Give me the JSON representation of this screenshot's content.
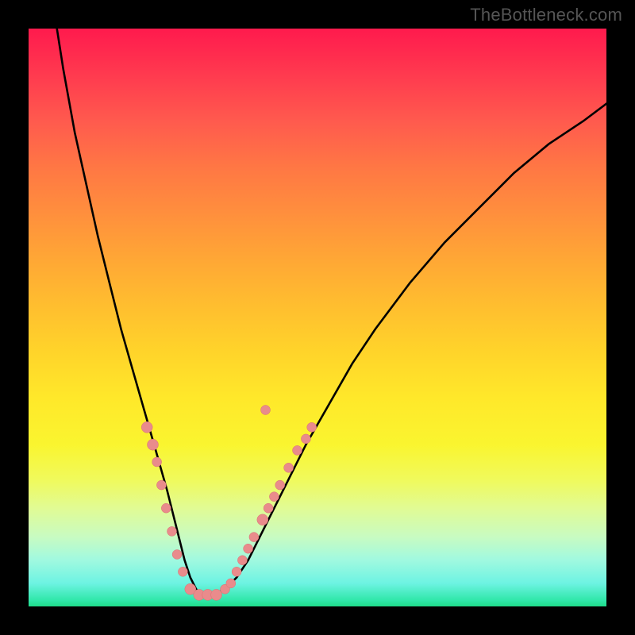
{
  "watermark": "TheBottleneck.com",
  "chart_data": {
    "type": "line",
    "title": "",
    "xlabel": "",
    "ylabel": "",
    "xlim": [
      0,
      100
    ],
    "ylim": [
      0,
      100
    ],
    "grid": false,
    "legend": false,
    "annotations": [],
    "series": [
      {
        "name": "bottleneck-curve",
        "color": "#000000",
        "x": [
          4.9,
          6,
          8,
          10,
          12,
          14,
          16,
          18,
          20,
          22,
          24,
          25,
          26,
          27,
          28,
          29,
          30,
          32,
          34,
          36,
          38,
          40,
          44,
          48,
          52,
          56,
          60,
          66,
          72,
          78,
          84,
          90,
          96,
          100
        ],
        "y": [
          100,
          93,
          82,
          73,
          64,
          56,
          48,
          41,
          34,
          27,
          20,
          16,
          12,
          8,
          5,
          3,
          2,
          2,
          3,
          5,
          8,
          12,
          20,
          28,
          35,
          42,
          48,
          56,
          63,
          69,
          75,
          80,
          84,
          87
        ]
      }
    ],
    "markers": [
      {
        "x": 20.5,
        "y": 31,
        "r": 7
      },
      {
        "x": 21.5,
        "y": 28,
        "r": 7
      },
      {
        "x": 22.2,
        "y": 25,
        "r": 6
      },
      {
        "x": 23.0,
        "y": 21,
        "r": 6
      },
      {
        "x": 23.8,
        "y": 17,
        "r": 6
      },
      {
        "x": 24.8,
        "y": 13,
        "r": 6
      },
      {
        "x": 25.7,
        "y": 9,
        "r": 6
      },
      {
        "x": 26.7,
        "y": 6,
        "r": 6
      },
      {
        "x": 28.0,
        "y": 3,
        "r": 7
      },
      {
        "x": 29.5,
        "y": 2,
        "r": 7
      },
      {
        "x": 31.0,
        "y": 2,
        "r": 7
      },
      {
        "x": 32.5,
        "y": 2,
        "r": 7
      },
      {
        "x": 34.0,
        "y": 3,
        "r": 6
      },
      {
        "x": 35.0,
        "y": 4,
        "r": 6
      },
      {
        "x": 36.0,
        "y": 6,
        "r": 6
      },
      {
        "x": 37.0,
        "y": 8,
        "r": 6
      },
      {
        "x": 38.0,
        "y": 10,
        "r": 6
      },
      {
        "x": 39.0,
        "y": 12,
        "r": 6
      },
      {
        "x": 40.5,
        "y": 15,
        "r": 7
      },
      {
        "x": 41.5,
        "y": 17,
        "r": 6
      },
      {
        "x": 42.5,
        "y": 19,
        "r": 6
      },
      {
        "x": 43.5,
        "y": 21,
        "r": 6
      },
      {
        "x": 45.0,
        "y": 24,
        "r": 6
      },
      {
        "x": 46.5,
        "y": 27,
        "r": 6
      },
      {
        "x": 48.0,
        "y": 29,
        "r": 6
      },
      {
        "x": 49.0,
        "y": 31,
        "r": 6
      },
      {
        "x": 41.0,
        "y": 34,
        "r": 6
      }
    ]
  },
  "colors": {
    "curve": "#000000",
    "marker_fill": "#e98b8c",
    "marker_stroke": "#d87272",
    "frame": "#000000"
  }
}
